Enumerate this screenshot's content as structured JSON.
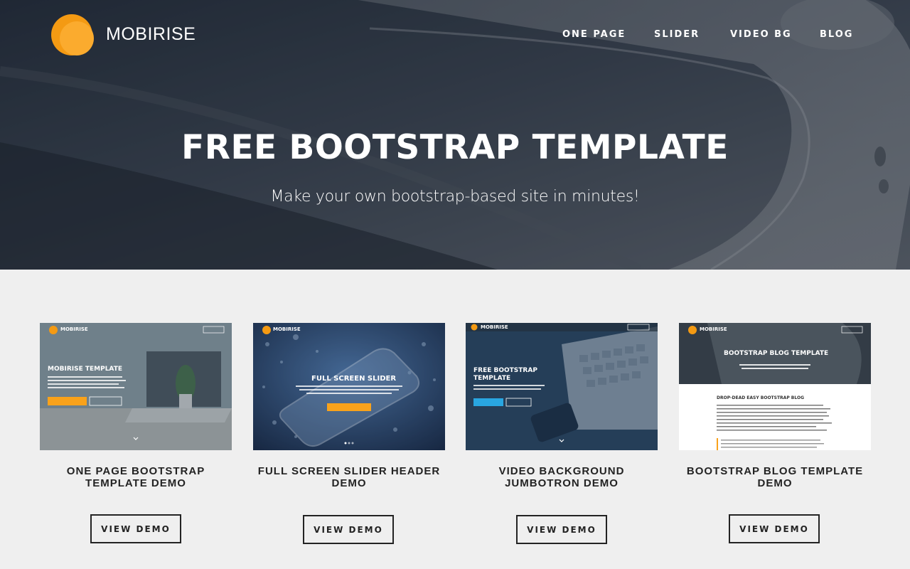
{
  "header": {
    "brand": "MOBIRISE",
    "nav": [
      "ONE PAGE",
      "SLIDER",
      "VIDEO BG",
      "BLOG"
    ]
  },
  "hero": {
    "title": "FREE BOOTSTRAP TEMPLATE",
    "subtitle": "Make your own bootstrap-based site in minutes!"
  },
  "cards": [
    {
      "title_line1": "ONE PAGE BOOTSTRAP",
      "title_line2": "TEMPLATE DEMO",
      "button": "VIEW DEMO",
      "preview": {
        "brand": "MOBIRISE",
        "heading": "MOBIRISE TEMPLATE"
      }
    },
    {
      "title_line1": "FULL SCREEN SLIDER HEADER",
      "title_line2": "DEMO",
      "button": "VIEW DEMO",
      "preview": {
        "brand": "MOBIRISE",
        "heading": "FULL SCREEN SLIDER"
      }
    },
    {
      "title_line1": "VIDEO BACKGROUND",
      "title_line2": "JUMBOTRON DEMO",
      "button": "VIEW DEMO",
      "preview": {
        "brand": "MOBIRISE",
        "heading_line1": "FREE BOOTSTRAP",
        "heading_line2": "TEMPLATE"
      }
    },
    {
      "title_line1": "BOOTSTRAP BLOG TEMPLATE",
      "title_line2": "DEMO",
      "button": "VIEW DEMO",
      "preview": {
        "brand": "MOBIRISE",
        "heading": "BOOTSTRAP BLOG TEMPLATE",
        "post_title": "DROP-DEAD EASY BOOTSTRAP BLOG"
      }
    }
  ],
  "colors": {
    "accent": "#f9a21b",
    "text_dark": "#232323",
    "page_bg": "#efefef",
    "hero_dark": "#2b3441"
  }
}
